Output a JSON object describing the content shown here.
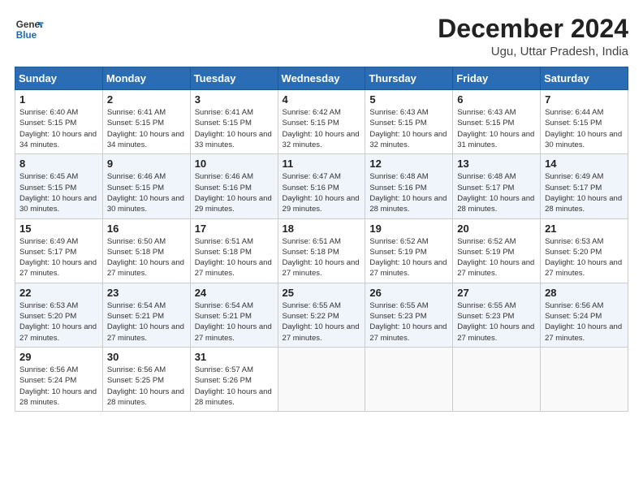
{
  "logo": {
    "line1": "General",
    "line2": "Blue"
  },
  "title": "December 2024",
  "subtitle": "Ugu, Uttar Pradesh, India",
  "days_of_week": [
    "Sunday",
    "Monday",
    "Tuesday",
    "Wednesday",
    "Thursday",
    "Friday",
    "Saturday"
  ],
  "weeks": [
    [
      {
        "day": "1",
        "sunrise": "6:40 AM",
        "sunset": "5:15 PM",
        "daylight": "10 hours and 34 minutes."
      },
      {
        "day": "2",
        "sunrise": "6:41 AM",
        "sunset": "5:15 PM",
        "daylight": "10 hours and 34 minutes."
      },
      {
        "day": "3",
        "sunrise": "6:41 AM",
        "sunset": "5:15 PM",
        "daylight": "10 hours and 33 minutes."
      },
      {
        "day": "4",
        "sunrise": "6:42 AM",
        "sunset": "5:15 PM",
        "daylight": "10 hours and 32 minutes."
      },
      {
        "day": "5",
        "sunrise": "6:43 AM",
        "sunset": "5:15 PM",
        "daylight": "10 hours and 32 minutes."
      },
      {
        "day": "6",
        "sunrise": "6:43 AM",
        "sunset": "5:15 PM",
        "daylight": "10 hours and 31 minutes."
      },
      {
        "day": "7",
        "sunrise": "6:44 AM",
        "sunset": "5:15 PM",
        "daylight": "10 hours and 30 minutes."
      }
    ],
    [
      {
        "day": "8",
        "sunrise": "6:45 AM",
        "sunset": "5:15 PM",
        "daylight": "10 hours and 30 minutes."
      },
      {
        "day": "9",
        "sunrise": "6:46 AM",
        "sunset": "5:15 PM",
        "daylight": "10 hours and 30 minutes."
      },
      {
        "day": "10",
        "sunrise": "6:46 AM",
        "sunset": "5:16 PM",
        "daylight": "10 hours and 29 minutes."
      },
      {
        "day": "11",
        "sunrise": "6:47 AM",
        "sunset": "5:16 PM",
        "daylight": "10 hours and 29 minutes."
      },
      {
        "day": "12",
        "sunrise": "6:48 AM",
        "sunset": "5:16 PM",
        "daylight": "10 hours and 28 minutes."
      },
      {
        "day": "13",
        "sunrise": "6:48 AM",
        "sunset": "5:17 PM",
        "daylight": "10 hours and 28 minutes."
      },
      {
        "day": "14",
        "sunrise": "6:49 AM",
        "sunset": "5:17 PM",
        "daylight": "10 hours and 28 minutes."
      }
    ],
    [
      {
        "day": "15",
        "sunrise": "6:49 AM",
        "sunset": "5:17 PM",
        "daylight": "10 hours and 27 minutes."
      },
      {
        "day": "16",
        "sunrise": "6:50 AM",
        "sunset": "5:18 PM",
        "daylight": "10 hours and 27 minutes."
      },
      {
        "day": "17",
        "sunrise": "6:51 AM",
        "sunset": "5:18 PM",
        "daylight": "10 hours and 27 minutes."
      },
      {
        "day": "18",
        "sunrise": "6:51 AM",
        "sunset": "5:18 PM",
        "daylight": "10 hours and 27 minutes."
      },
      {
        "day": "19",
        "sunrise": "6:52 AM",
        "sunset": "5:19 PM",
        "daylight": "10 hours and 27 minutes."
      },
      {
        "day": "20",
        "sunrise": "6:52 AM",
        "sunset": "5:19 PM",
        "daylight": "10 hours and 27 minutes."
      },
      {
        "day": "21",
        "sunrise": "6:53 AM",
        "sunset": "5:20 PM",
        "daylight": "10 hours and 27 minutes."
      }
    ],
    [
      {
        "day": "22",
        "sunrise": "6:53 AM",
        "sunset": "5:20 PM",
        "daylight": "10 hours and 27 minutes."
      },
      {
        "day": "23",
        "sunrise": "6:54 AM",
        "sunset": "5:21 PM",
        "daylight": "10 hours and 27 minutes."
      },
      {
        "day": "24",
        "sunrise": "6:54 AM",
        "sunset": "5:21 PM",
        "daylight": "10 hours and 27 minutes."
      },
      {
        "day": "25",
        "sunrise": "6:55 AM",
        "sunset": "5:22 PM",
        "daylight": "10 hours and 27 minutes."
      },
      {
        "day": "26",
        "sunrise": "6:55 AM",
        "sunset": "5:23 PM",
        "daylight": "10 hours and 27 minutes."
      },
      {
        "day": "27",
        "sunrise": "6:55 AM",
        "sunset": "5:23 PM",
        "daylight": "10 hours and 27 minutes."
      },
      {
        "day": "28",
        "sunrise": "6:56 AM",
        "sunset": "5:24 PM",
        "daylight": "10 hours and 27 minutes."
      }
    ],
    [
      {
        "day": "29",
        "sunrise": "6:56 AM",
        "sunset": "5:24 PM",
        "daylight": "10 hours and 28 minutes."
      },
      {
        "day": "30",
        "sunrise": "6:56 AM",
        "sunset": "5:25 PM",
        "daylight": "10 hours and 28 minutes."
      },
      {
        "day": "31",
        "sunrise": "6:57 AM",
        "sunset": "5:26 PM",
        "daylight": "10 hours and 28 minutes."
      },
      null,
      null,
      null,
      null
    ]
  ],
  "labels": {
    "sunrise": "Sunrise:",
    "sunset": "Sunset:",
    "daylight": "Daylight:"
  }
}
